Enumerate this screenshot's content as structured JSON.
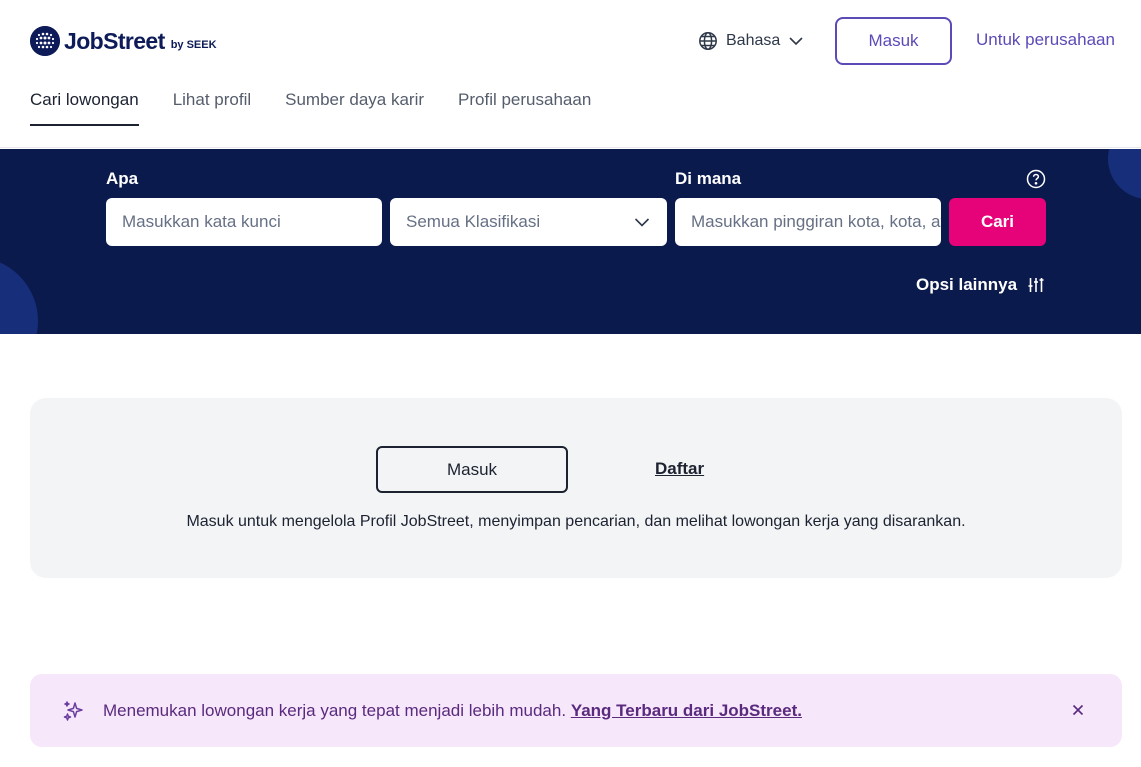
{
  "brand": {
    "name": "JobStreet",
    "sub": "by SEEK",
    "color": "#0d1b58"
  },
  "header": {
    "language_label": "Bahasa",
    "login_label": "Masuk",
    "employer_label": "Untuk perusahaan",
    "accent": "#5b4bb7"
  },
  "tabs": [
    {
      "label": "Cari lowongan",
      "active": true
    },
    {
      "label": "Lihat profil",
      "active": false
    },
    {
      "label": "Sumber daya karir",
      "active": false
    },
    {
      "label": "Profil perusahaan",
      "active": false
    }
  ],
  "search": {
    "what_label": "Apa",
    "keyword_placeholder": "Masukkan kata kunci",
    "classification_value": "Semua Klasifikasi",
    "where_label": "Di mana",
    "location_placeholder": "Masukkan pinggiran kota, kota, atau wilayah",
    "search_button": "Cari",
    "more_options": "Opsi lainnya",
    "background": "#0b1a4d",
    "button_color": "#e60278"
  },
  "signin_card": {
    "login_button": "Masuk",
    "register_link": "Daftar",
    "description": "Masuk untuk mengelola Profil JobStreet, menyimpan pencarian, dan melihat lowongan kerja yang disarankan."
  },
  "banner": {
    "text": "Menemukan lowongan kerja yang tepat menjadi lebih mudah.",
    "link": "Yang Terbaru dari JobStreet.",
    "background": "#f6e7fa"
  },
  "icons": {
    "logo": "jobstreet-globe-icon",
    "language": "globe-icon",
    "dropdown": "chevron-down-icon",
    "help": "question-circle-icon",
    "filters": "sliders-icon",
    "sparkle": "sparkle-icon",
    "close": "close-icon"
  }
}
